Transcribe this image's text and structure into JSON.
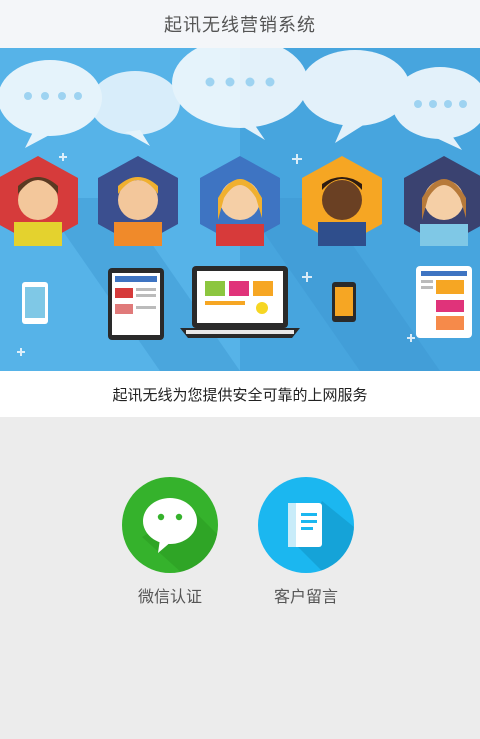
{
  "header": {
    "title": "起讯无线营销系统"
  },
  "banner": {
    "tagline": "起讯无线为您提供安全可靠的上网服务"
  },
  "actions": [
    {
      "label": "微信认证",
      "icon": "wechat-icon",
      "color": "#35b22c"
    },
    {
      "label": "客户留言",
      "icon": "message-book-icon",
      "color": "#1bb7f0"
    }
  ],
  "colors": {
    "banner_bg": "#4aa9e0",
    "page_bg": "#ececec"
  }
}
